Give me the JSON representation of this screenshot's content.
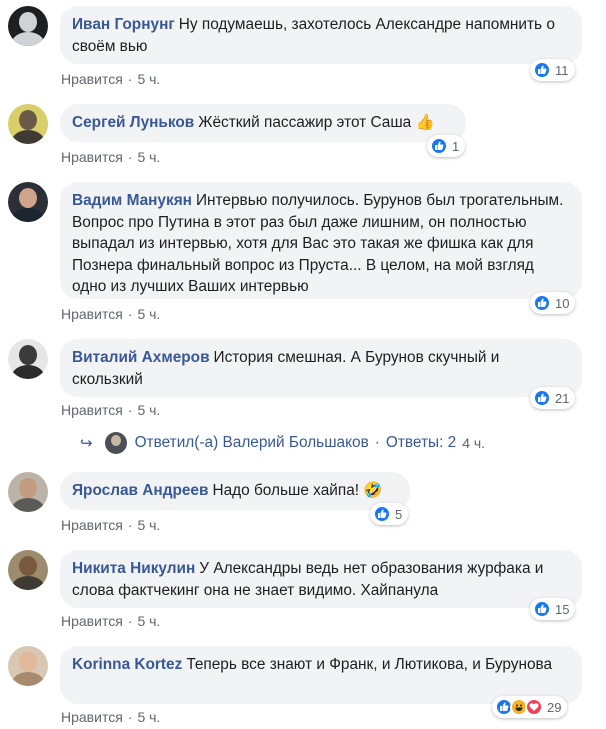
{
  "like_label": "Нравится",
  "dot": "·",
  "comments": [
    {
      "author": "Иван Горнунг",
      "text": "Ну подумаешь, захотелось Александре напомнить о своём вью",
      "reactions": [
        "like"
      ],
      "count": "11",
      "time": "5 ч.",
      "avatar_bg": "#1e1f21",
      "avatar_face": "#cfd3d8"
    },
    {
      "author": "Сергей Луньков",
      "text": "Жёсткий пассажир этот Саша 👍",
      "reactions": [
        "like"
      ],
      "count": "1",
      "time": "5 ч.",
      "avatar_bg": "#d9cf6a",
      "avatar_face": "#6b5a46"
    },
    {
      "author": "Вадим Манукян",
      "text": "Интервью получилось. Бурунов был трогательным. Вопрос про Путина в этот раз был даже лишним, он полностью выпадал из интервью, хотя для Вас это такая же фишка как для Познера финальный вопрос из Пруста... В целом, на мой взгляд одно из лучших Ваших интервью",
      "reactions": [
        "like"
      ],
      "count": "10",
      "time": "5 ч.",
      "avatar_bg": "#2a2f38",
      "avatar_face": "#d0a48a"
    },
    {
      "author": "Виталий Ахмеров",
      "text": "История смешная. А Бурунов скучный и скользкий",
      "reactions": [
        "like"
      ],
      "count": "21",
      "time": "5 ч.",
      "avatar_bg": "#e6e6e6",
      "avatar_face": "#3a3a3a"
    },
    {
      "author": "Ярослав Андреев",
      "text": "Надо больше хайпа! 🤣",
      "reactions": [
        "like"
      ],
      "count": "5",
      "time": "5 ч.",
      "avatar_bg": "#b9b3a8",
      "avatar_face": "#c59b7f"
    },
    {
      "author": "Никита Никулин",
      "text": "У Александры ведь нет образования журфака и слова фактчекинг она не знает видимо. Хайпанула",
      "reactions": [
        "like"
      ],
      "count": "15",
      "time": "5 ч.",
      "avatar_bg": "#9c8c6d",
      "avatar_face": "#7a5a3e"
    },
    {
      "author": "Korinna Kortez",
      "text": "Теперь все знают и Франк, и Лютикова, и Бурунова",
      "reactions": [
        "like",
        "haha",
        "love"
      ],
      "count": "29",
      "time": "5 ч.",
      "avatar_bg": "#d8c7b3",
      "avatar_face": "#e2b89a"
    }
  ],
  "replies": {
    "arrow": "↪",
    "text": "Ответил(-а) Валерий Большаков",
    "count_text": "Ответы: 2",
    "time": "4 ч."
  },
  "colors": {
    "link": "#385898",
    "bubble": "#f2f3f5",
    "meta": "#606770",
    "like_blue": "#1877f2"
  }
}
